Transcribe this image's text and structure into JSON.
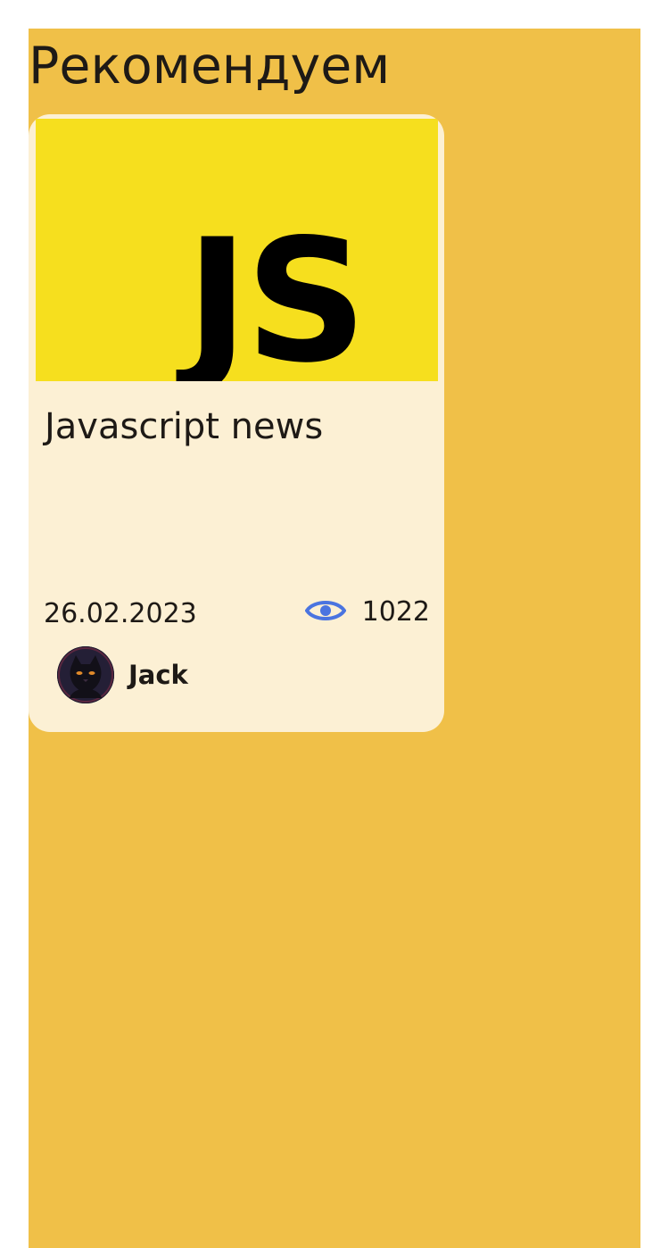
{
  "section": {
    "title": "Рекомендуем"
  },
  "card": {
    "cover_logo_text": "JS",
    "title": "Javascript news",
    "date": "26.02.2023",
    "views": "1022",
    "views_icon": "eye-icon",
    "author": {
      "name": "Jack",
      "avatar_icon": "cat-avatar"
    }
  },
  "colors": {
    "page_background": "#f0c048",
    "card_background": "#fcf0d4",
    "cover_background": "#f6df1e",
    "eye_icon": "#4a74e0",
    "text": "#1e1a16"
  }
}
